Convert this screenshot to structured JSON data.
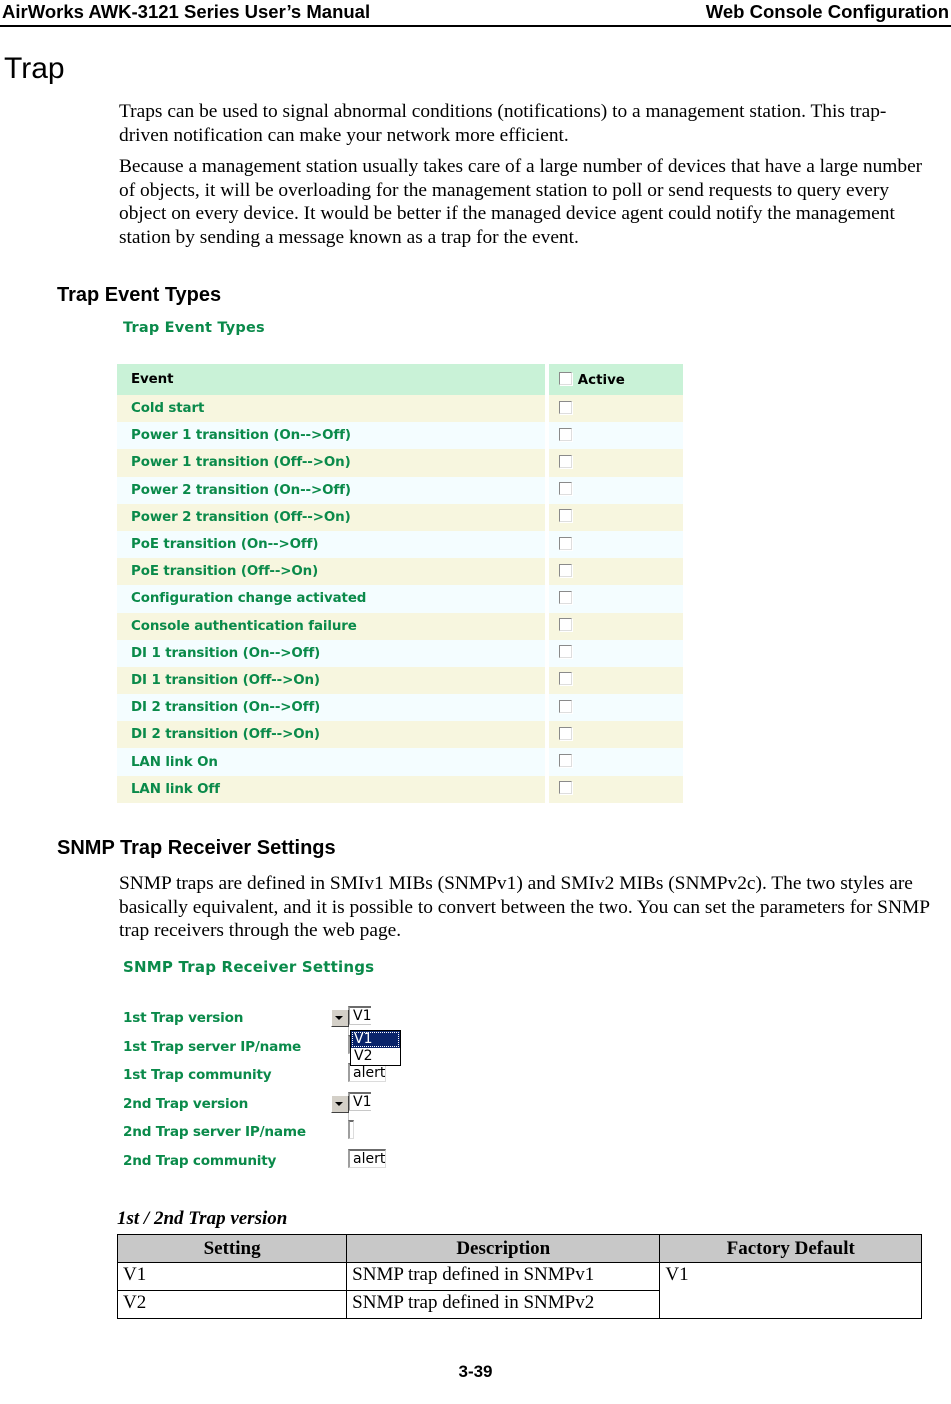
{
  "header": {
    "left_title": "AirWorks AWK-3121 Series User’s Manual",
    "right_title": "Web Console Configuration"
  },
  "page_title": "Trap",
  "paragraphs": {
    "intro_1": "Traps can be used to signal abnormal conditions (notifications) to a management station. This trap-driven notification can make your network more efficient.",
    "intro_2": "Because a management station usually takes care of a large number of devices that have a large number of objects, it will be overloading for the management station to poll or send requests to query every object on every device. It would be better if the managed device agent could notify the management station by sending a message known as a trap for the event.",
    "snmp_intro": "SNMP traps are defined in SMIv1 MIBs (SNMPv1) and SMIv2 MIBs (SNMPv2c). The two styles are basically equivalent, and it is possible to convert between the two. You can set the parameters for SNMP trap receivers through the web page."
  },
  "sections": {
    "trap_event_types_heading": "Trap Event Types",
    "snmp_trap_receiver_heading": "SNMP Trap Receiver Settings"
  },
  "trap_event_types": {
    "panel_caption": "Trap Event Types",
    "columns": {
      "event": "Event",
      "active": "Active"
    },
    "rows": [
      {
        "event": "Cold start"
      },
      {
        "event": "Power 1 transition (On-->Off)"
      },
      {
        "event": "Power 1 transition (Off-->On)"
      },
      {
        "event": "Power 2 transition (On-->Off)"
      },
      {
        "event": "Power 2 transition (Off-->On)"
      },
      {
        "event": "PoE transition (On-->Off)"
      },
      {
        "event": "PoE transition (Off-->On)"
      },
      {
        "event": "Configuration change activated"
      },
      {
        "event": "Console authentication failure"
      },
      {
        "event": "DI 1 transition (On-->Off)"
      },
      {
        "event": "DI 1 transition (Off-->On)"
      },
      {
        "event": "DI 2 transition (On-->Off)"
      },
      {
        "event": "DI 2 transition (Off-->On)"
      },
      {
        "event": "LAN link On"
      },
      {
        "event": "LAN link Off"
      }
    ]
  },
  "snmp_trap_receiver": {
    "panel_caption": "SNMP Trap Receiver Settings",
    "fields": {
      "trap1_version_label": "1st Trap version",
      "trap1_version_value": "V1",
      "trap1_server_label": "1st Trap server IP/name",
      "trap1_server_value": "",
      "trap1_community_label": "1st Trap community",
      "trap1_community_value": "alert",
      "trap2_version_label": "2nd Trap version",
      "trap2_version_value": "V1",
      "trap2_server_label": "2nd Trap server IP/name",
      "trap2_server_value": "",
      "trap2_community_label": "2nd Trap community",
      "trap2_community_value": "alert"
    },
    "version_options": [
      "V1",
      "V2"
    ],
    "open_dropdown_selected": "V1"
  },
  "reference_table": {
    "caption": "1st / 2nd Trap version",
    "headers": [
      "Setting",
      "Description",
      "Factory Default"
    ],
    "rows": [
      {
        "setting": "V1",
        "description": "SNMP trap defined in SNMPv1"
      },
      {
        "setting": "V2",
        "description": "SNMP trap defined in SNMPv2"
      }
    ],
    "factory_default": "V1"
  },
  "footer": {
    "page_number": "3-39"
  },
  "colors": {
    "console_green": "#0a8a4a",
    "table_header_green": "#c9f2d7",
    "row_alt_cream": "#f7f6df",
    "row_alt_cyan": "#f4fdff",
    "dropdown_highlight": "#0a246a",
    "ref_header_gray": "#c8c8c8"
  }
}
